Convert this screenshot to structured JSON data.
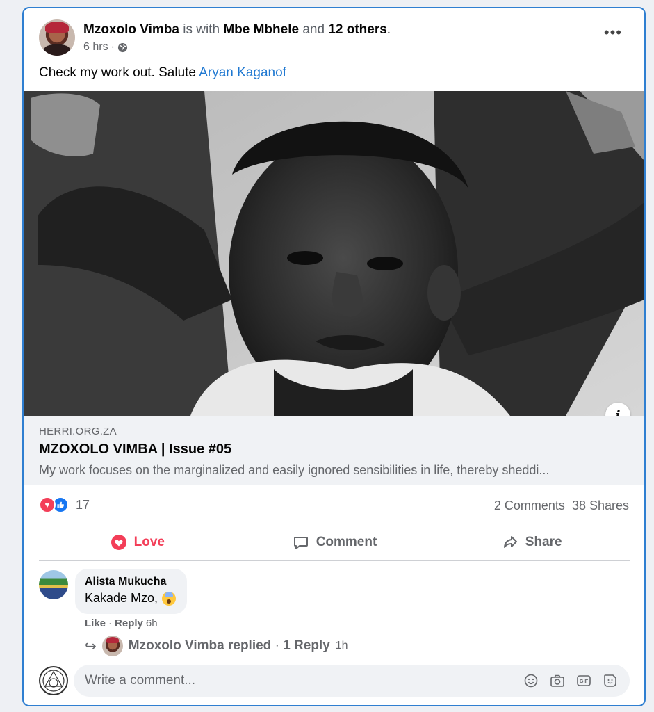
{
  "post": {
    "author": "Mzoxolo Vimba",
    "with_text": "is with",
    "tagged": "Mbe Mbhele",
    "and_text": "and",
    "others": "12 others",
    "period": ".",
    "time": "6 hrs",
    "dot": "·",
    "audience_icon": "globe-icon",
    "text_prefix": "Check my work out. Salute ",
    "text_link": "Aryan Kaganof",
    "more_icon": "more-options-icon"
  },
  "link_preview": {
    "domain": "HERRI.ORG.ZA",
    "title": "MZOXOLO VIMBA | Issue #05",
    "description": "My work focuses on the marginalized and easily ignored sensibilities in life, thereby sheddi..."
  },
  "reactions": {
    "count": "17",
    "comments": "2 Comments",
    "shares": "38 Shares"
  },
  "actions": {
    "love": "Love",
    "comment": "Comment",
    "share": "Share"
  },
  "comment": {
    "author": "Alista Mukucha",
    "text": "Kakade Mzo,",
    "like": "Like",
    "sep": "·",
    "reply": "Reply",
    "time": "6h"
  },
  "reply": {
    "author_replied": "Mzoxolo Vimba replied",
    "sep": "·",
    "count": "1 Reply",
    "time": "1h"
  },
  "composer": {
    "placeholder": "Write a comment..."
  },
  "colors": {
    "accent": "#1f78d1",
    "love": "#f33e58",
    "like": "#1877f2",
    "frame": "#2f7fd1"
  }
}
